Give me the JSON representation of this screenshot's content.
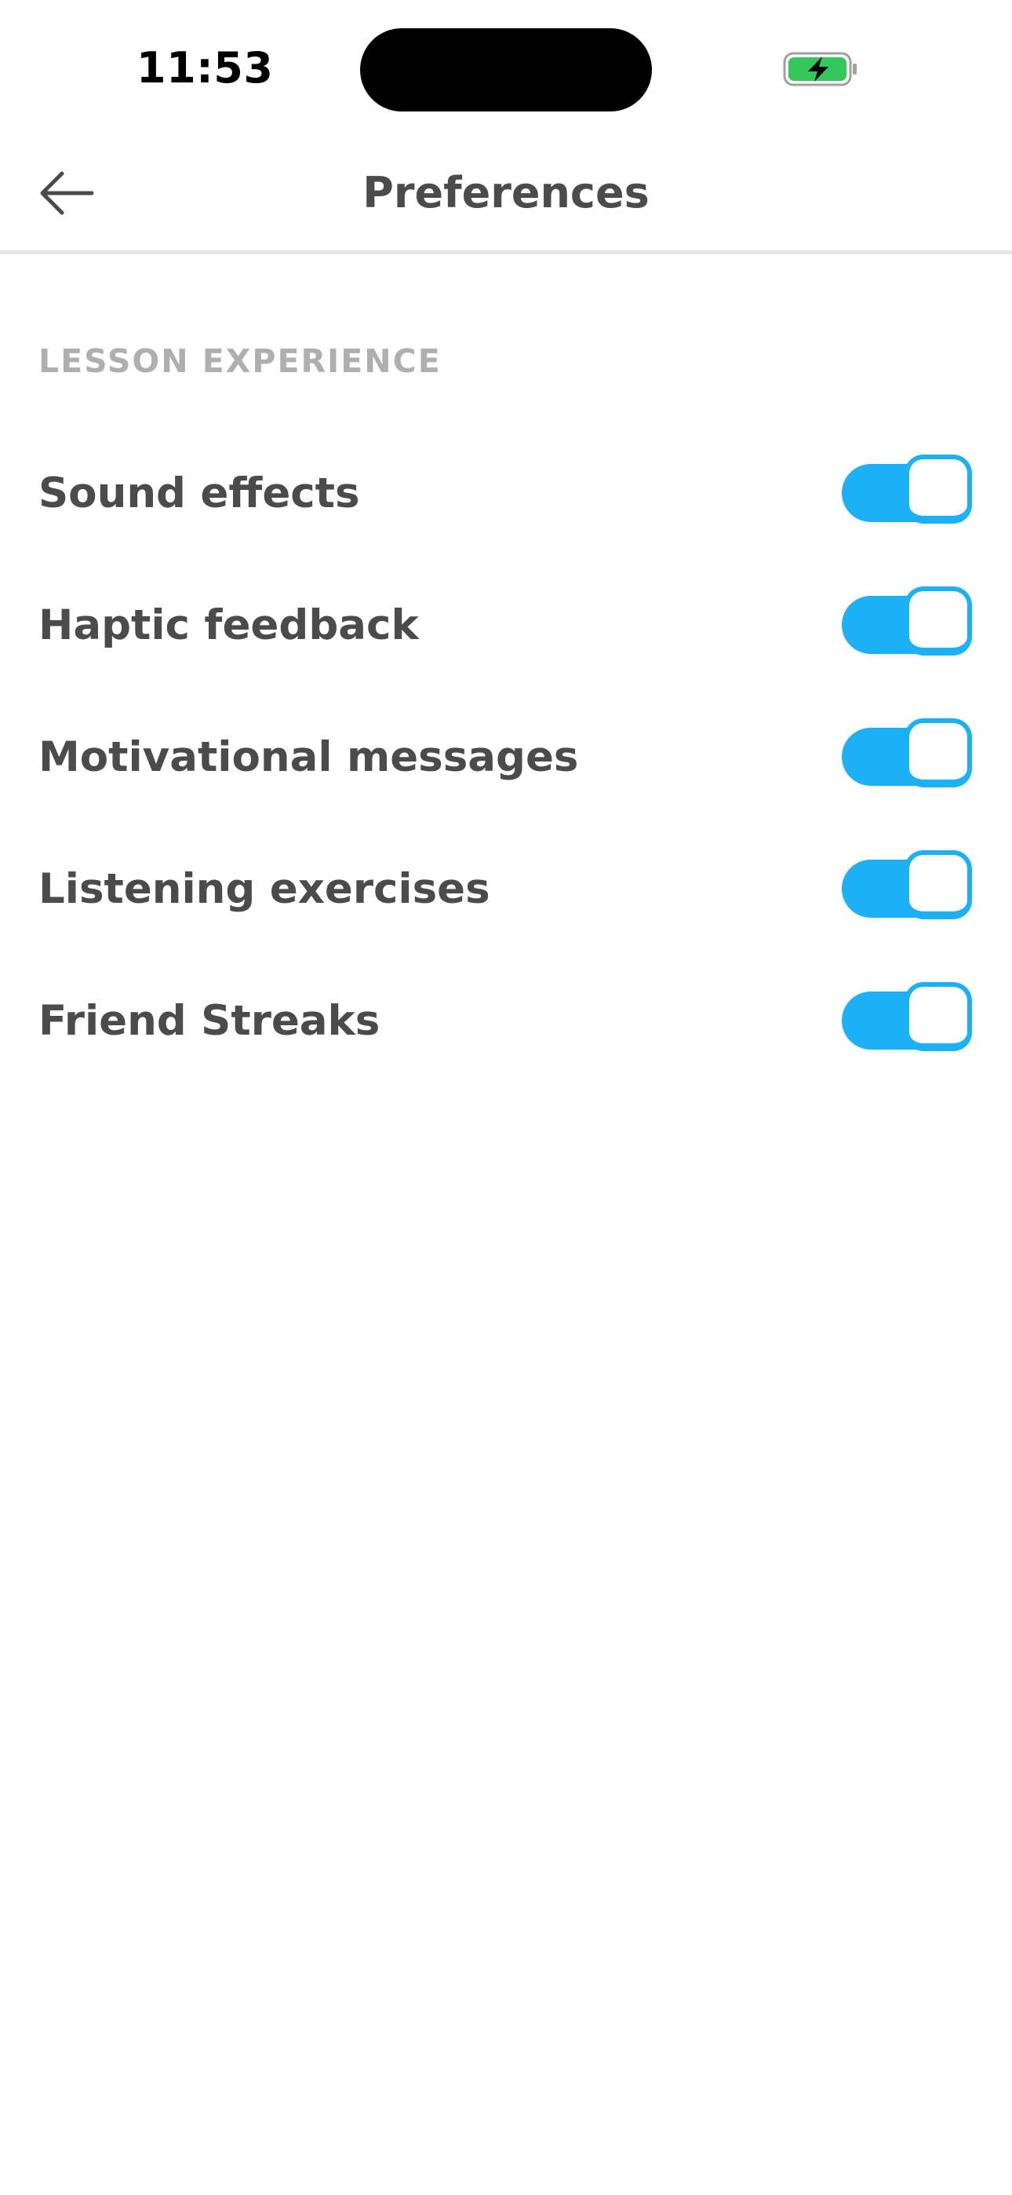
{
  "status_bar": {
    "time": "11:53",
    "battery_icon": "battery-charging-icon",
    "battery_color": "#34c759"
  },
  "header": {
    "back_icon": "arrow-left-icon",
    "title": "Preferences"
  },
  "section": {
    "title": "LESSON EXPERIENCE"
  },
  "settings": [
    {
      "label": "Sound effects",
      "enabled": true
    },
    {
      "label": "Haptic feedback",
      "enabled": true
    },
    {
      "label": "Motivational messages",
      "enabled": true
    },
    {
      "label": "Listening exercises",
      "enabled": true
    },
    {
      "label": "Friend Streaks",
      "enabled": true
    }
  ],
  "colors": {
    "accent": "#1cb0f6",
    "text_primary": "#4b4b4b",
    "text_secondary": "#afafaf",
    "divider": "#e5e5e5"
  }
}
